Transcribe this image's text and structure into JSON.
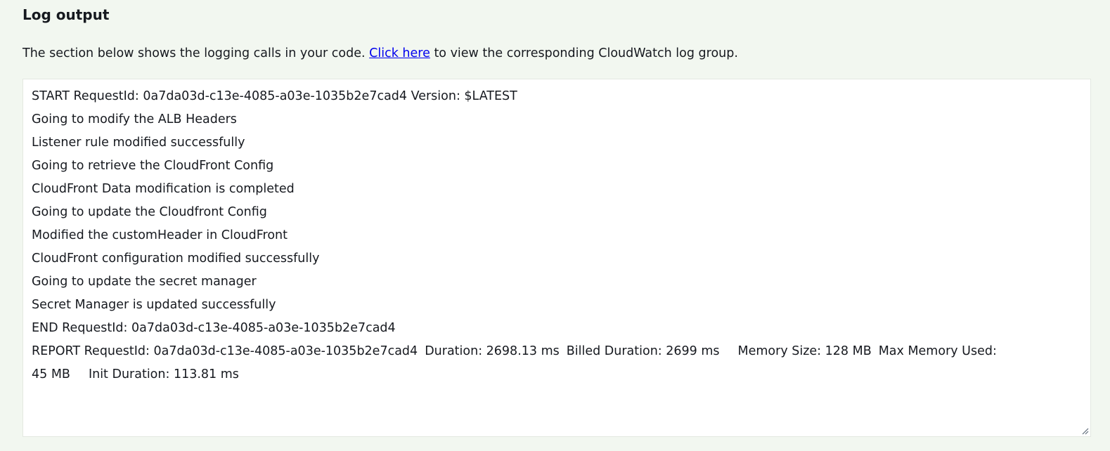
{
  "section": {
    "title": "Log output",
    "description_prefix": "The section below shows the logging calls in your code.",
    "description_link": "Click here",
    "description_suffix": "to view the corresponding CloudWatch log group."
  },
  "log": {
    "lines": [
      "START RequestId: 0a7da03d-c13e-4085-a03e-1035b2e7cad4 Version: $LATEST",
      "Going to modify the ALB Headers",
      "Listener rule modified successfully",
      "Going to retrieve the CloudFront Config",
      "CloudFront Data modification is completed",
      "Going to update the Cloudfront Config",
      "Modified the customHeader in CloudFront",
      "CloudFront configuration modified successfully",
      "Going to update the secret manager",
      "Secret Manager is updated successfully",
      "END RequestId: 0a7da03d-c13e-4085-a03e-1035b2e7cad4"
    ],
    "report": {
      "request_id": "REPORT RequestId: 0a7da03d-c13e-4085-a03e-1035b2e7cad4",
      "duration": "Duration: 2698.13 ms",
      "billed_duration": "Billed Duration: 2699 ms",
      "memory_size": "Memory Size: 128 MB",
      "max_memory_used": "Max Memory Used:",
      "max_memory_value": "45 MB",
      "init_duration": "Init Duration: 113.81 ms"
    }
  },
  "icons": {
    "resize_handle": "resize-grip-icon"
  }
}
